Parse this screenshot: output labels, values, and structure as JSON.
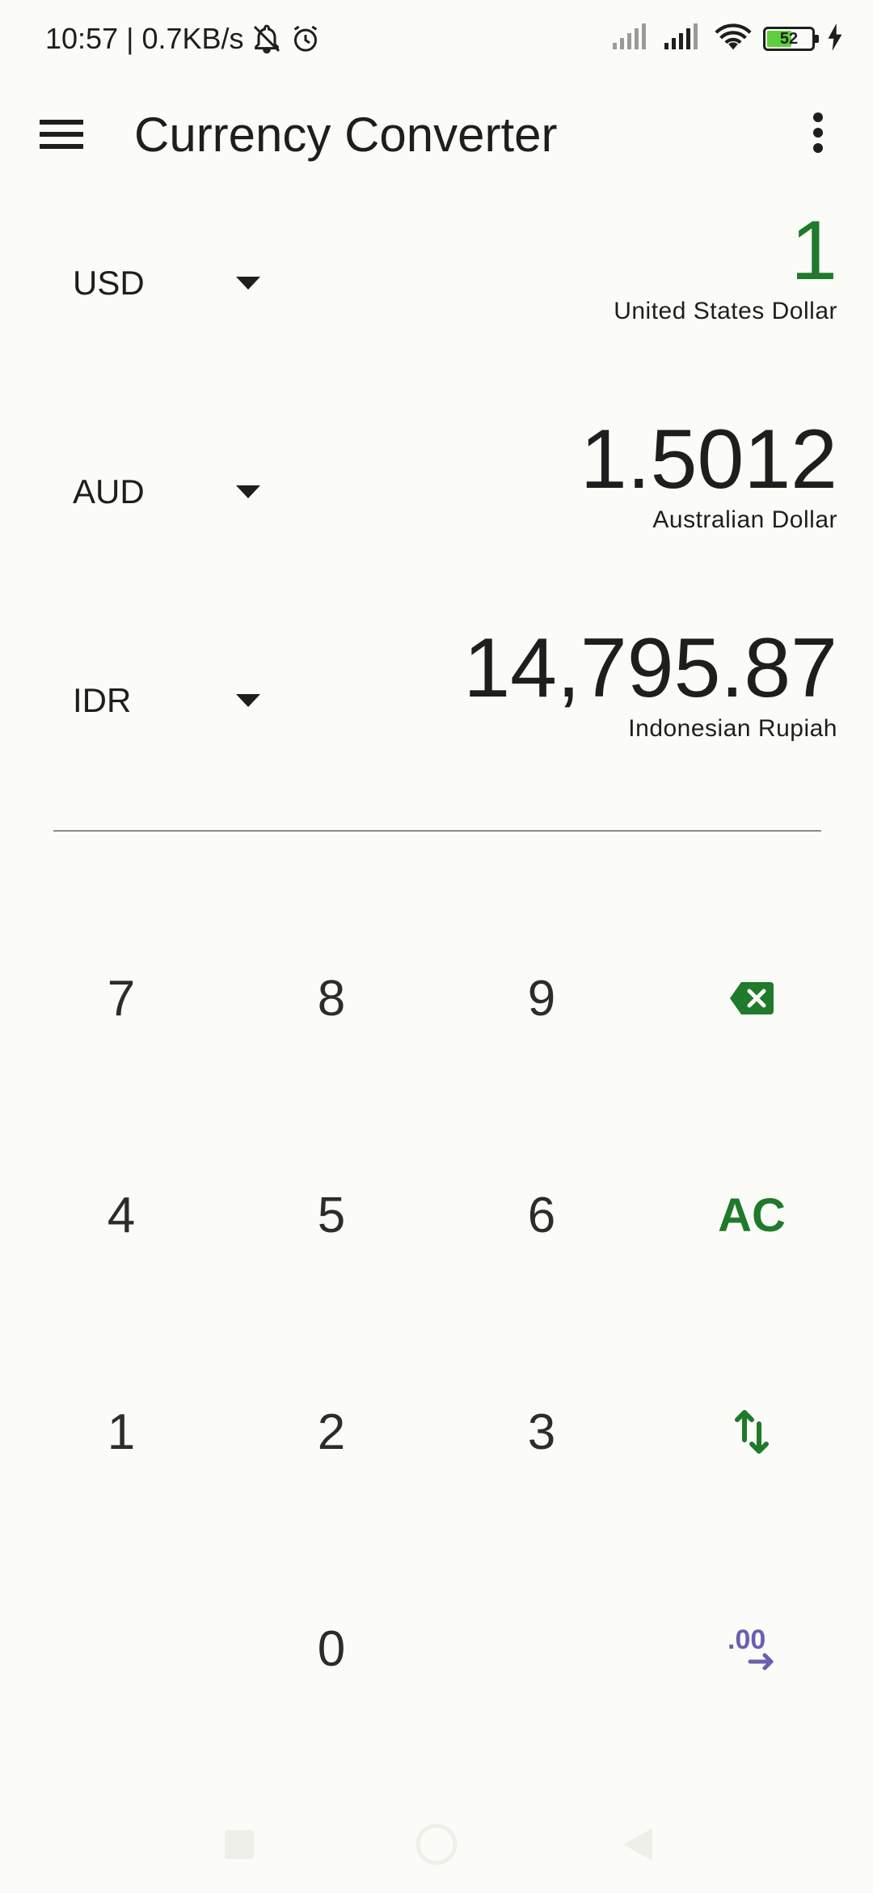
{
  "status_bar": {
    "time_speed": "10:57 | 0.7KB/s",
    "battery_level": "52",
    "icons": [
      "mute-bell-icon",
      "alarm-icon",
      "signal-icon",
      "signal-icon",
      "wifi-icon",
      "battery-icon",
      "charging-icon"
    ]
  },
  "app_bar": {
    "title": "Currency Converter",
    "menu_icon": "hamburger-menu-icon",
    "more_icon": "more-vert-icon"
  },
  "currencies": [
    {
      "code": "USD",
      "amount": "1",
      "name": "United States Dollar",
      "active": true
    },
    {
      "code": "AUD",
      "amount": "1.5012",
      "name": "Australian Dollar",
      "active": false
    },
    {
      "code": "IDR",
      "amount": "14,795.87",
      "name": "Indonesian Rupiah",
      "active": false
    }
  ],
  "keypad": {
    "k7": "7",
    "k8": "8",
    "k9": "9",
    "backspace": "backspace-icon",
    "k4": "4",
    "k5": "5",
    "k6": "6",
    "clear": "AC",
    "k1": "1",
    "k2": "2",
    "k3": "3",
    "swap": "swap-vert-icon",
    "k0": "0",
    "decimal_label": ".00",
    "decimal_icon": "decimal-increase-icon"
  },
  "colors": {
    "accent": "#1f7a2b",
    "secondary": "#6b5fb0",
    "background": "#fbfcf7"
  }
}
